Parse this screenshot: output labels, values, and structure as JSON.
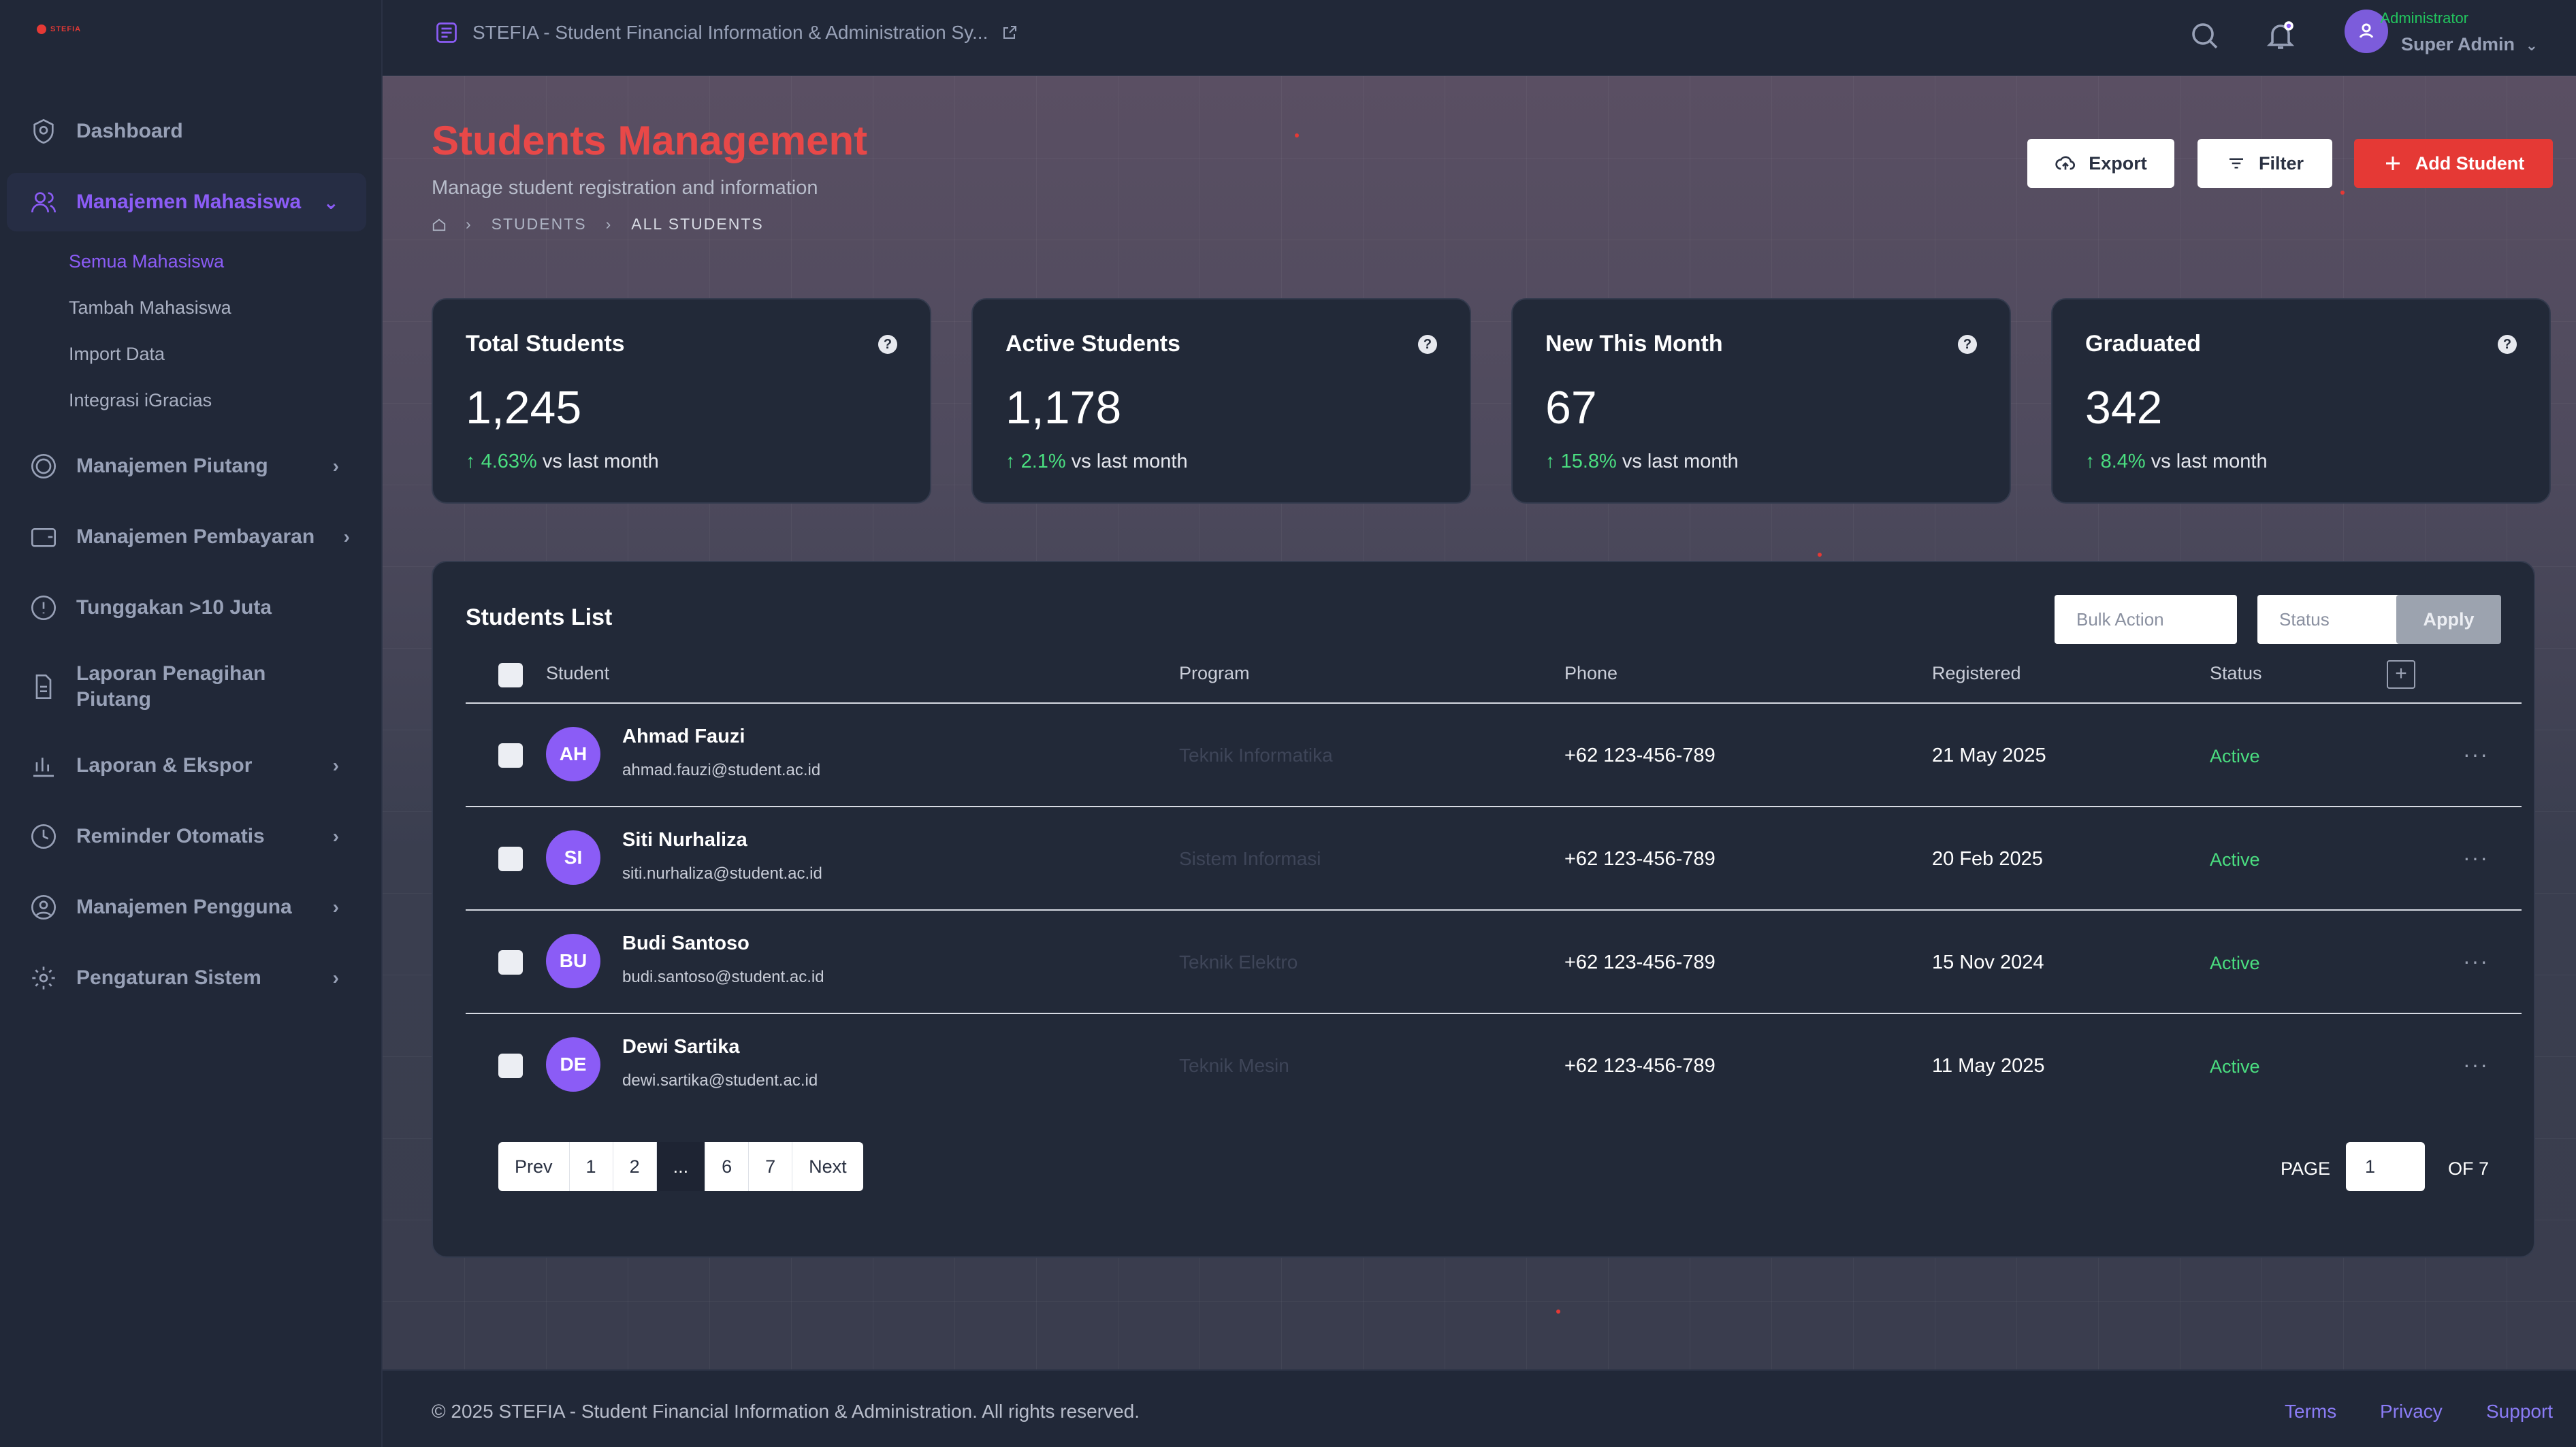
{
  "app": {
    "logo_text": "STEFIA"
  },
  "sidebar": {
    "items": [
      {
        "label": "Dashboard"
      },
      {
        "label": "Manajemen Mahasiswa",
        "children": [
          "Semua Mahasiswa",
          "Tambah Mahasiswa",
          "Import Data",
          "Integrasi iGracias"
        ]
      },
      {
        "label": "Manajemen Piutang"
      },
      {
        "label": "Manajemen Pembayaran"
      },
      {
        "label": "Tunggakan >10 Juta"
      },
      {
        "label": "Laporan Penagihan Piutang"
      },
      {
        "label": "Laporan & Ekspor"
      },
      {
        "label": "Reminder Otomatis"
      },
      {
        "label": "Manajemen Pengguna"
      },
      {
        "label": "Pengaturan Sistem"
      }
    ]
  },
  "topbar": {
    "title": "STEFIA - Student Financial Information & Administration Sy...",
    "user_role": "Administrator",
    "user_name": "Super Admin"
  },
  "page": {
    "title": "Students Management",
    "subtitle": "Manage student registration and information",
    "breadcrumb": [
      "STUDENTS",
      "ALL STUDENTS"
    ],
    "actions": {
      "export": "Export",
      "filter": "Filter",
      "add": "Add Student"
    }
  },
  "stats": [
    {
      "label": "Total Students",
      "value": "1,245",
      "change": "4.63%",
      "suffix": "vs last month"
    },
    {
      "label": "Active Students",
      "value": "1,178",
      "change": "2.1%",
      "suffix": "vs last month"
    },
    {
      "label": "New This Month",
      "value": "67",
      "change": "15.8%",
      "suffix": "vs last month"
    },
    {
      "label": "Graduated",
      "value": "342",
      "change": "8.4%",
      "suffix": "vs last month"
    }
  ],
  "list": {
    "title": "Students List",
    "bulk_placeholder": "Bulk Action",
    "status_placeholder": "Status",
    "apply": "Apply",
    "columns": [
      "Student",
      "Program",
      "Phone",
      "Registered",
      "Status"
    ],
    "rows": [
      {
        "initials": "AH",
        "name": "Ahmad Fauzi",
        "email": "ahmad.fauzi@student.ac.id",
        "program": "Teknik Informatika",
        "phone": "+62 123-456-789",
        "registered": "21 May 2025",
        "status": "Active"
      },
      {
        "initials": "SI",
        "name": "Siti Nurhaliza",
        "email": "siti.nurhaliza@student.ac.id",
        "program": "Sistem Informasi",
        "phone": "+62 123-456-789",
        "registered": "20 Feb 2025",
        "status": "Active"
      },
      {
        "initials": "BU",
        "name": "Budi Santoso",
        "email": "budi.santoso@student.ac.id",
        "program": "Teknik Elektro",
        "phone": "+62 123-456-789",
        "registered": "15 Nov 2024",
        "status": "Active"
      },
      {
        "initials": "DE",
        "name": "Dewi Sartika",
        "email": "dewi.sartika@student.ac.id",
        "program": "Teknik Mesin",
        "phone": "+62 123-456-789",
        "registered": "11 May 2025",
        "status": "Active"
      }
    ],
    "pagination": {
      "pages": [
        "Prev",
        "1",
        "2",
        "...",
        "6",
        "7",
        "Next"
      ],
      "page_label": "PAGE",
      "page_value": "1",
      "of_label": "OF 7"
    }
  },
  "footer": {
    "copyright": "© 2025 STEFIA - Student Financial Information & Administration. All rights reserved.",
    "links": [
      "Terms",
      "Privacy",
      "Support"
    ]
  },
  "colors": {
    "accent": "#8b5cf6",
    "brand_red": "#e53935",
    "positive": "#4ade80"
  }
}
